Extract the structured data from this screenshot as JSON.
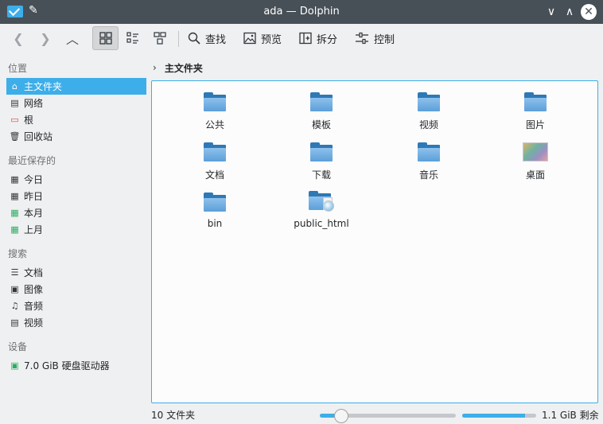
{
  "window": {
    "title": "ada — Dolphin",
    "min_glyph": "∨",
    "max_glyph": "∧",
    "close_glyph": "✕"
  },
  "toolbar": {
    "back_glyph": "❮",
    "forward_glyph": "❯",
    "up_glyph": "︿",
    "find_label": "查找",
    "preview_label": "预览",
    "split_label": "拆分",
    "control_label": "控制"
  },
  "sidebar": {
    "places_title": "位置",
    "places": [
      {
        "label": "主文件夹",
        "icon": "home-icon",
        "glyph": "⌂"
      },
      {
        "label": "网络",
        "icon": "network-icon",
        "glyph": "▤"
      },
      {
        "label": "根",
        "icon": "root-folder-icon",
        "glyph": "▭"
      },
      {
        "label": "回收站",
        "icon": "trash-icon",
        "glyph": "🗑"
      }
    ],
    "recent_title": "最近保存的",
    "recent": [
      {
        "label": "今日",
        "icon": "calendar-icon",
        "glyph": "▦"
      },
      {
        "label": "昨日",
        "icon": "calendar-icon",
        "glyph": "▦"
      },
      {
        "label": "本月",
        "icon": "calendar-icon",
        "glyph": "▦"
      },
      {
        "label": "上月",
        "icon": "calendar-icon",
        "glyph": "▦"
      }
    ],
    "search_title": "搜索",
    "search": [
      {
        "label": "文档",
        "icon": "document-icon",
        "glyph": "☰"
      },
      {
        "label": "图像",
        "icon": "image-icon",
        "glyph": "▣"
      },
      {
        "label": "音频",
        "icon": "audio-icon",
        "glyph": "♫"
      },
      {
        "label": "视频",
        "icon": "video-icon",
        "glyph": "▤"
      }
    ],
    "devices_title": "设备",
    "devices": [
      {
        "label": "7.0 GiB 硬盘驱动器",
        "icon": "harddrive-icon",
        "glyph": "▣"
      }
    ]
  },
  "breadcrumb": {
    "chevron": "›",
    "current": "主文件夹"
  },
  "files": [
    {
      "name": "公共",
      "type": "folder"
    },
    {
      "name": "模板",
      "type": "folder"
    },
    {
      "name": "视频",
      "type": "folder"
    },
    {
      "name": "图片",
      "type": "folder"
    },
    {
      "name": "文档",
      "type": "folder"
    },
    {
      "name": "下载",
      "type": "folder"
    },
    {
      "name": "音乐",
      "type": "folder"
    },
    {
      "name": "桌面",
      "type": "desktop"
    },
    {
      "name": "bin",
      "type": "folder"
    },
    {
      "name": "public_html",
      "type": "web-folder"
    }
  ],
  "status": {
    "count_text": "10 文件夹",
    "zoom_level": 0.16,
    "free_space_text": "1.1 GiB 剩余",
    "used_fraction": 0.85
  }
}
